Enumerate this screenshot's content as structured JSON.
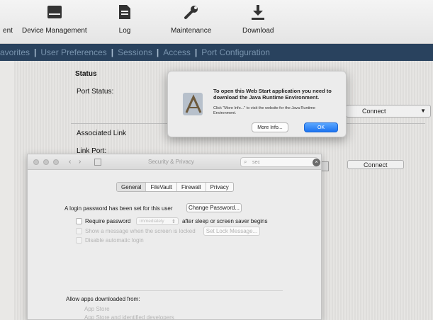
{
  "toolbar": {
    "items": [
      {
        "label": "ent",
        "icon": "none"
      },
      {
        "label": "Device Management",
        "icon": "server-icon"
      },
      {
        "label": "Log",
        "icon": "document-icon"
      },
      {
        "label": "Maintenance",
        "icon": "wrench-icon"
      },
      {
        "label": "Download",
        "icon": "download-icon"
      }
    ]
  },
  "nav": {
    "tabs": [
      "avorites",
      "User Preferences",
      "Sessions",
      "Access",
      "Port Configuration"
    ]
  },
  "main": {
    "status_heading": "Status",
    "port_status_label": "Port Status:",
    "connect_select_1": "Connect",
    "associated_link_label": "Associated Link",
    "link_port_label": "Link Port:",
    "connect_select_2": "Connect"
  },
  "alert": {
    "title": "To open this Web Start application you need to download the Java Runtime Environment.",
    "body": "Click \"More Info...\" to visit the website for the Java Runtime Environment.",
    "more_info_label": "More Info...",
    "ok_label": "OK"
  },
  "security_window": {
    "title": "Security & Privacy",
    "search_value": "sec",
    "tabs": [
      {
        "label": "General",
        "active": true
      },
      {
        "label": "FileVault",
        "active": false
      },
      {
        "label": "Firewall",
        "active": false
      },
      {
        "label": "Privacy",
        "active": false
      }
    ],
    "login_text": "A login password has been set for this user",
    "change_password_label": "Change Password...",
    "require_password_label": "Require password",
    "require_password_value": "immediately",
    "after_sleep_label": "after sleep or screen saver begins",
    "show_message_label": "Show a message when the screen is locked",
    "set_lock_message_label": "Set Lock Message...",
    "disable_login_label": "Disable automatic login",
    "allow_apps_label": "Allow apps downloaded from:",
    "app_store_label": "App Store",
    "identified_label": "App Store and identified developers"
  },
  "colors": {
    "navbar": "#29425e",
    "ok_button": "#1d74f0"
  }
}
